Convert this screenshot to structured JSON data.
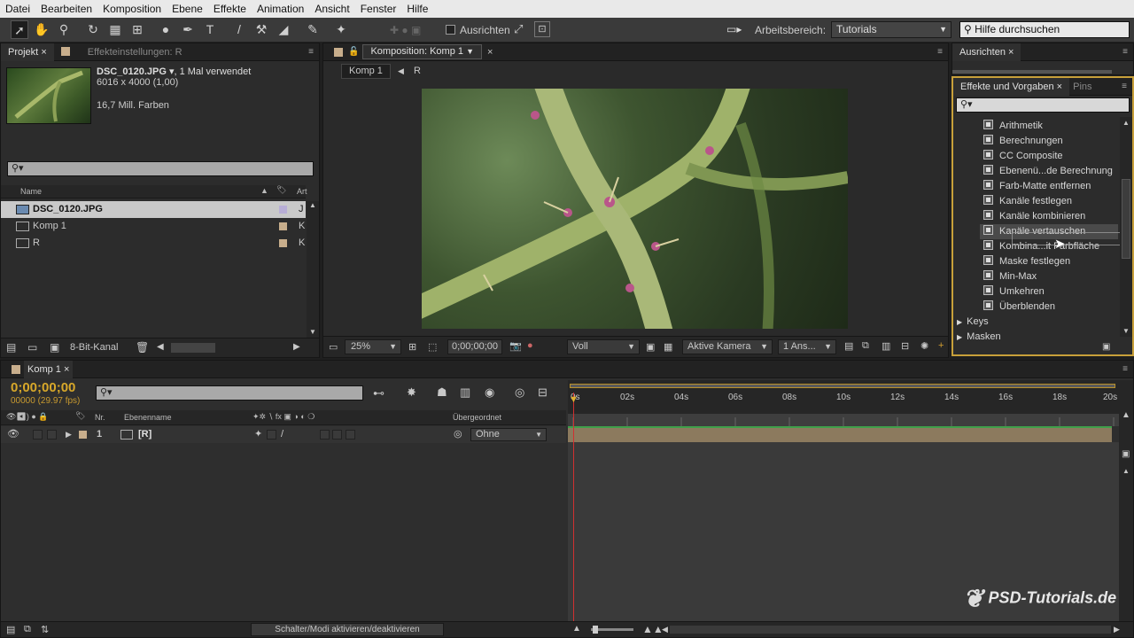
{
  "menu": [
    "Datei",
    "Bearbeiten",
    "Komposition",
    "Ebene",
    "Effekte",
    "Animation",
    "Ansicht",
    "Fenster",
    "Hilfe"
  ],
  "toolbar": {
    "align_label": "Ausrichten",
    "workspace_label": "Arbeitsbereich:",
    "workspace_value": "Tutorials",
    "help_placeholder": "Hilfe durchsuchen"
  },
  "project": {
    "tab_project": "Projekt",
    "tab_effects": "Effekteinstellungen: R",
    "file_name": "DSC_0120.JPG",
    "file_usage": ", 1 Mal verwendet",
    "file_dims": "6016 x 4000 (1,00)",
    "file_colors": "16,7 Mill. Farben",
    "col_name": "Name",
    "col_type": "Art",
    "items": [
      {
        "name": "DSC_0120.JPG",
        "type": "J",
        "color": "#b8aed6"
      },
      {
        "name": "Komp 1",
        "type": "K",
        "color": "#c8ae8c"
      },
      {
        "name": "R",
        "type": "K",
        "color": "#c8ae8c"
      }
    ],
    "bit_depth": "8-Bit-Kanal"
  },
  "comp": {
    "tab": "Komposition: Komp 1",
    "breadcrumb_1": "Komp 1",
    "breadcrumb_2": "R",
    "zoom": "25%",
    "timecode": "0;00;00;00",
    "resolution": "Voll",
    "camera": "Aktive Kamera",
    "views": "1 Ans..."
  },
  "align_panel": {
    "tab": "Ausrichten"
  },
  "effects": {
    "tab": "Effekte und Vorgaben",
    "tab2": "Pins",
    "items": [
      "Arithmetik",
      "Berechnungen",
      "CC Composite",
      "Ebenenü...de Berechnung",
      "Farb-Matte entfernen",
      "Kanäle festlegen",
      "Kanäle kombinieren",
      "Kanäle vertauschen",
      "Kombina...it Farbfläche",
      "Maske festlegen",
      "Min-Max",
      "Umkehren",
      "Überblenden"
    ],
    "groups": [
      "Keys",
      "Masken"
    ]
  },
  "timeline": {
    "tab": "Komp 1",
    "timecode": "0;00;00;00",
    "fps": "00000 (29.97 fps)",
    "col_nr": "Nr.",
    "col_layername": "Ebenenname",
    "col_parent": "Übergeordnet",
    "layer_nr": "1",
    "layer_name": "[R]",
    "layer_parent": "Ohne",
    "toggle_label": "Schalter/Modi aktivieren/deaktivieren",
    "ruler": [
      "0s",
      "02s",
      "04s",
      "06s",
      "08s",
      "10s",
      "12s",
      "14s",
      "16s",
      "18s",
      "20s"
    ]
  },
  "watermark": "PSD-Tutorials.de"
}
